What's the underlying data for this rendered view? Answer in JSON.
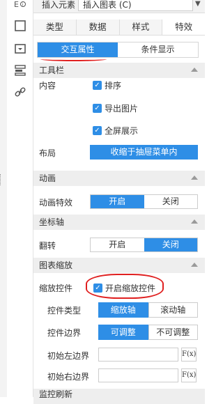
{
  "top": {
    "insert_label": "插入元素",
    "insert_value": "插入图表 (C)"
  },
  "tabs": [
    "类型",
    "数据",
    "样式",
    "特效"
  ],
  "subtabs": [
    "交互属性",
    "条件显示"
  ],
  "toolbar": {
    "section_title": "工具栏",
    "content_label": "内容",
    "options": [
      "排序",
      "导出图片",
      "全屏展示"
    ],
    "layout_label": "布局",
    "layout_value": "收缩于抽屉菜单内"
  },
  "animation": {
    "section_title": "动画",
    "label": "动画特效",
    "options": [
      "开启",
      "关闭"
    ],
    "selected": "开启"
  },
  "axis": {
    "section_title": "坐标轴",
    "label": "翻转",
    "options": [
      "开启",
      "关闭"
    ],
    "selected": "关闭"
  },
  "zoom": {
    "section_title": "图表缩放",
    "control_label": "缩放控件",
    "enable_text": "开启缩放控件",
    "type_label": "控件类型",
    "type_options": [
      "缩放轴",
      "滚动轴"
    ],
    "type_selected": "缩放轴",
    "edge_label": "控件边界",
    "edge_options": [
      "可调整",
      "不可调整"
    ],
    "edge_selected": "可调整",
    "left_label": "初始左边界",
    "right_label": "初始右边界",
    "fx": "F(x)"
  },
  "bottom_section": "监控刷新",
  "colors": {
    "accent": "#2e8ee6",
    "highlight": "#e02020"
  },
  "icons": [
    "info-icon",
    "frame-icon",
    "dropdown-icon",
    "layers-icon",
    "link-icon"
  ]
}
